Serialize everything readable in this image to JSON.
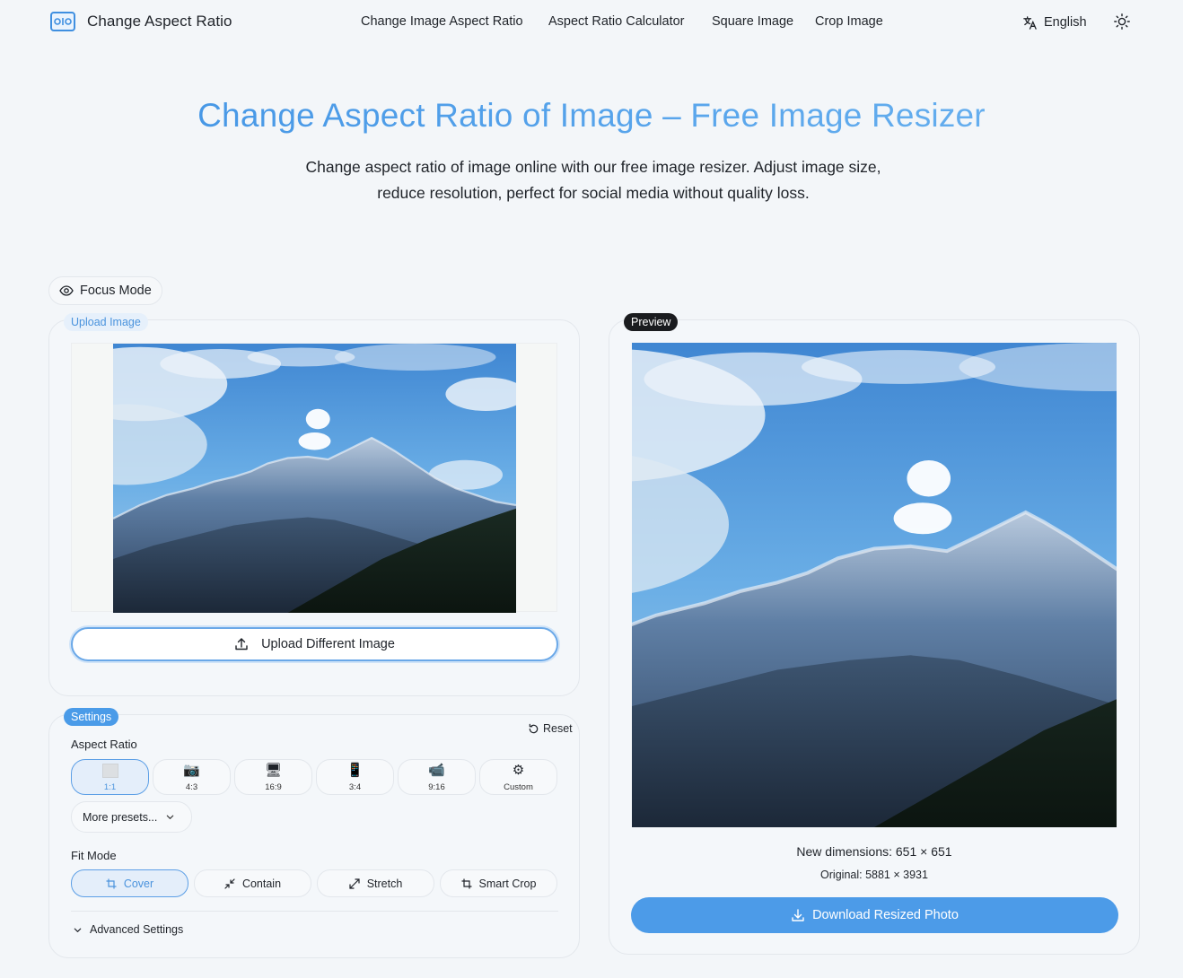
{
  "header": {
    "brand": "Change Aspect Ratio",
    "nav": [
      "Change Image Aspect Ratio",
      "Aspect Ratio Calculator",
      "Square Image",
      "Crop Image"
    ],
    "language": "English",
    "logo_icon": "aspect-ratio-logo-icon",
    "theme_icon": "sun-icon",
    "language_icon": "translate-icon"
  },
  "hero": {
    "title": "Change Aspect Ratio of Image – Free Image Resizer",
    "subtitle": "Change aspect ratio of image online with our free image resizer. Adjust image size, reduce resolution, perfect for social media without quality loss."
  },
  "focus_mode": {
    "label": "Focus Mode",
    "icon": "eye-icon"
  },
  "upload": {
    "tag": "Upload Image",
    "button_label": "Upload Different Image",
    "button_icon": "upload-icon"
  },
  "settings": {
    "tag": "Settings",
    "reset_label": "Reset",
    "aspect_ratio_label": "Aspect Ratio",
    "ratios": [
      {
        "label": "1:1",
        "icon": "square-icon",
        "active": true
      },
      {
        "label": "4:3",
        "icon": "camera-icon",
        "glyph": "📷"
      },
      {
        "label": "16:9",
        "icon": "monitor-icon",
        "glyph": "🖥"
      },
      {
        "label": "3:4",
        "icon": "phone-icon",
        "glyph": "📱"
      },
      {
        "label": "9:16",
        "icon": "video-camera-icon",
        "glyph": "📹"
      },
      {
        "label": "Custom",
        "icon": "gear-icon",
        "glyph": "⚙"
      }
    ],
    "more_presets": "More presets...",
    "fit_mode_label": "Fit Mode",
    "fit_modes": [
      {
        "label": "Cover",
        "icon": "crop-icon",
        "active": true
      },
      {
        "label": "Contain",
        "icon": "shrink-icon"
      },
      {
        "label": "Stretch",
        "icon": "expand-icon"
      },
      {
        "label": "Smart Crop",
        "icon": "crop-icon"
      }
    ],
    "advanced_label": "Advanced Settings"
  },
  "preview": {
    "tag": "Preview",
    "new_dimensions": "New dimensions: 651 × 651",
    "original": "Original: 5881 × 3931",
    "download_label": "Download Resized Photo",
    "download_icon": "download-icon"
  },
  "colors": {
    "accent": "#4a9be8",
    "background": "#f3f6f9",
    "dark_tag": "#1a1c1f"
  }
}
